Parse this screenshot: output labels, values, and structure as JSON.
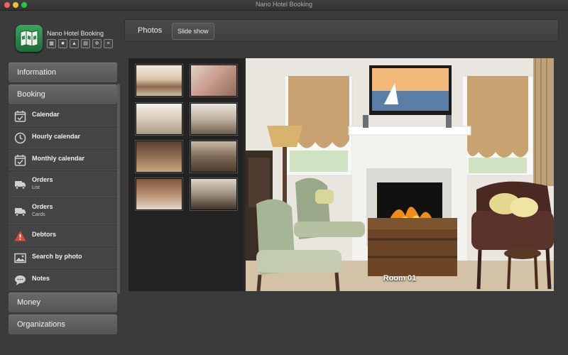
{
  "window": {
    "title": "Nano Hotel Booking"
  },
  "app": {
    "name": "Nano Hotel Booking"
  },
  "header_icons": [
    "calendar-icon",
    "truck-icon",
    "warning-icon",
    "clipboard-icon",
    "gears-icon",
    "database-icon"
  ],
  "sidebar": {
    "sections": {
      "information": "Information",
      "booking": "Booking",
      "money": "Money",
      "organizations": "Organizations"
    },
    "booking_items": [
      {
        "label": "Calendar",
        "icon": "calendar-check-icon"
      },
      {
        "label": "Hourly calendar",
        "icon": "clock-icon"
      },
      {
        "label": "Monthly calendar",
        "icon": "calendar-check-icon"
      },
      {
        "label": "Orders",
        "sub": "List",
        "icon": "truck-icon"
      },
      {
        "label": "Orders",
        "sub": "Cards",
        "icon": "truck-icon"
      },
      {
        "label": "Debtors",
        "icon": "warning-icon"
      },
      {
        "label": "Search by photo",
        "icon": "image-icon"
      },
      {
        "label": "Notes",
        "icon": "speech-bubble-icon"
      }
    ]
  },
  "toolbar": {
    "title": "Photos",
    "slideshow_label": "Slide show"
  },
  "photo": {
    "caption": "Room 01",
    "thumbnail_count": 8
  },
  "colors": {
    "background": "#3b3b3b",
    "sidebar_header": "#5f5f5f",
    "logo_green": "#2e8b50",
    "warning_red": "#e0453a"
  }
}
